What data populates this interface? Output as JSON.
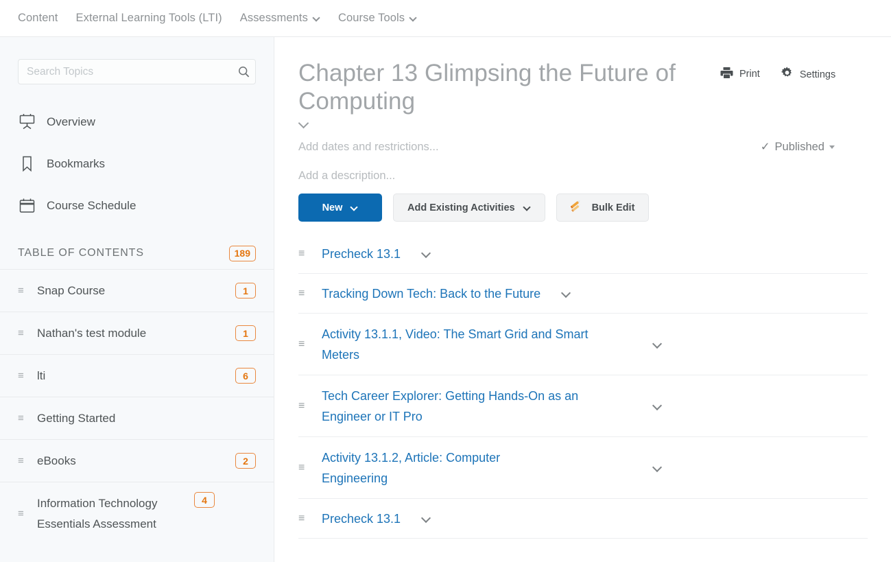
{
  "topnav": {
    "items": [
      {
        "label": "Content",
        "has_dropdown": false
      },
      {
        "label": "External Learning Tools (LTI)",
        "has_dropdown": false
      },
      {
        "label": "Assessments",
        "has_dropdown": true
      },
      {
        "label": "Course Tools",
        "has_dropdown": true
      }
    ]
  },
  "sidebar": {
    "search": {
      "value": "",
      "placeholder": "Search Topics",
      "icon": "search-icon"
    },
    "nav": [
      {
        "label": "Overview",
        "icon": "presentation-easel-icon"
      },
      {
        "label": "Bookmarks",
        "icon": "bookmark-icon"
      },
      {
        "label": "Course Schedule",
        "icon": "calendar-icon"
      }
    ],
    "toc": {
      "title": "TABLE OF CONTENTS",
      "count": "189",
      "items": [
        {
          "label": "Snap Course",
          "count": "1"
        },
        {
          "label": "Nathan's test module",
          "count": "1"
        },
        {
          "label": "lti",
          "count": "6"
        },
        {
          "label": "Getting Started",
          "count": ""
        },
        {
          "label": "eBooks",
          "count": "2"
        },
        {
          "label": "Information Technology Essentials Assessment",
          "count": "4"
        }
      ]
    }
  },
  "main": {
    "page_title": "Chapter 13 Glimpsing the Future of Computing",
    "tools": [
      {
        "label": "Print",
        "icon": "printer-icon"
      },
      {
        "label": "Settings",
        "icon": "gear-icon"
      }
    ],
    "dates_placeholder": "Add dates and restrictions...",
    "description_placeholder": "Add a description...",
    "publish_status": "Published",
    "publish_check": "✓",
    "buttons": [
      {
        "label": "New",
        "style": "primary",
        "has_dropdown": true,
        "icon": ""
      },
      {
        "label": "Add Existing Activities",
        "style": "secondary",
        "has_dropdown": true,
        "icon": ""
      },
      {
        "label": "Bulk Edit",
        "style": "secondary",
        "has_dropdown": false,
        "icon": "pencils-icon"
      }
    ],
    "items": [
      {
        "title": "Precheck 13.1",
        "lines": 1
      },
      {
        "title": "Tracking Down Tech: Back to the Future",
        "lines": 1
      },
      {
        "title": "Activity 13.1.1, Video: The Smart Grid and Smart Meters",
        "lines": 2
      },
      {
        "title": "Tech Career Explorer: Getting Hands-On as an Engineer or IT Pro",
        "lines": 2
      },
      {
        "title": "Activity 13.1.2, Article: Computer Engineering",
        "lines": 2
      },
      {
        "title": "Precheck 13.1",
        "lines": 1
      }
    ]
  },
  "colors": {
    "primary_blue": "#0c6ab1",
    "link_blue": "#1d74b8",
    "badge_orange": "#e4760f",
    "sidebar_bg": "#f7f9fb",
    "text_gray": "#4f5456"
  }
}
